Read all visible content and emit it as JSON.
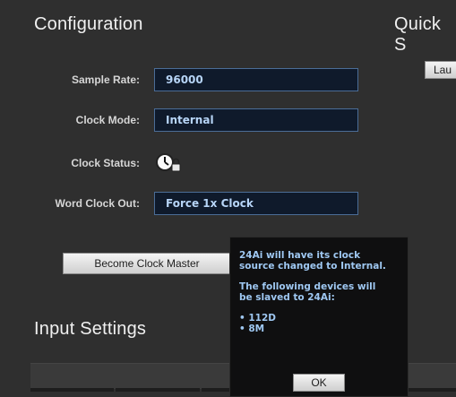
{
  "config": {
    "title": "Configuration",
    "rows": [
      {
        "label": "Sample Rate:",
        "value": "96000"
      },
      {
        "label": "Clock Mode:",
        "value": "Internal"
      },
      {
        "label": "Clock Status:",
        "icon": "clock-lock-icon"
      },
      {
        "label": "Word Clock Out:",
        "value": "Force 1x Clock"
      }
    ],
    "become_master_label": "Become Clock Master"
  },
  "quick_setup": {
    "title": "Quick S",
    "launch_label": "Lau"
  },
  "input_settings": {
    "title": "Input Settings"
  },
  "popup": {
    "line1": "24Ai will have its clock",
    "line2": "source changed to Internal.",
    "line3": "The following devices will",
    "line4": "be slaved to 24Ai:",
    "devices": [
      "112D",
      "8M"
    ],
    "ok_label": "OK"
  }
}
